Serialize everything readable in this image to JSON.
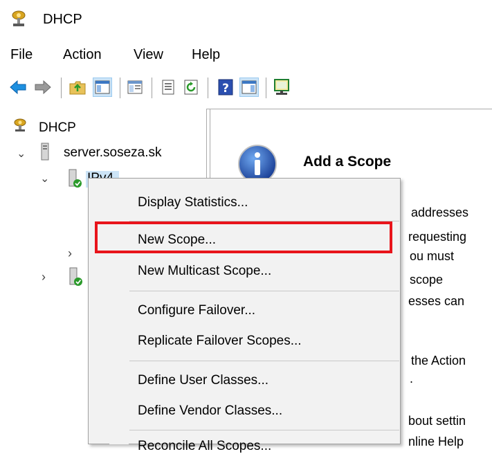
{
  "window": {
    "title": "DHCP"
  },
  "menu": {
    "file": "File",
    "action": "Action",
    "view": "View",
    "help": "Help"
  },
  "toolbar": {
    "icons": [
      "back-arrow-icon",
      "forward-arrow-icon",
      "up-folder-icon",
      "show-hide-console-tree-icon",
      "export-list-icon",
      "refresh-icon",
      "help-icon",
      "show-hide-action-pane-icon",
      "monitor-icon"
    ]
  },
  "tree": {
    "root": "DHCP",
    "server": "server.soseza.sk",
    "ipv4": "IPv4"
  },
  "content": {
    "heading": "Add a Scope",
    "lines": [
      "addresses",
      "requesting",
      "ou must",
      "scope",
      "esses can",
      "the Action",
      ".",
      "bout settin",
      "nline Help"
    ]
  },
  "context_menu": {
    "items": [
      "Display Statistics...",
      "New Scope...",
      "New Multicast Scope...",
      "Configure Failover...",
      "Replicate Failover Scopes...",
      "Define User Classes...",
      "Define Vendor Classes...",
      "Reconcile All Scopes..."
    ]
  },
  "colors": {
    "highlight": "#e8141b",
    "menu_bg": "#f2f2f2"
  }
}
